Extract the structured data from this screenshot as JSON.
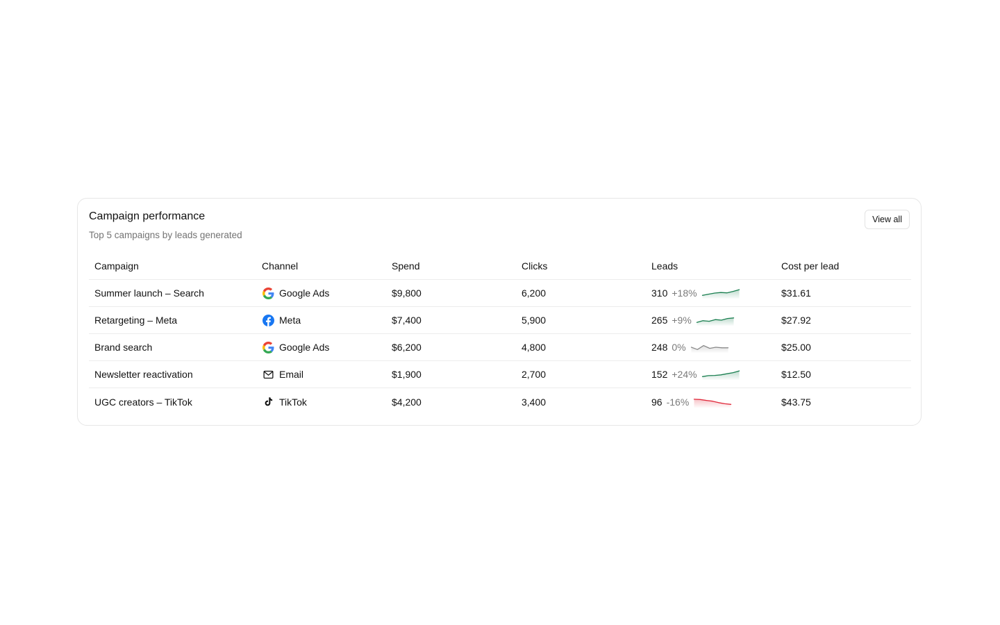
{
  "card": {
    "title": "Campaign performance",
    "subtitle": "Top 5 campaigns by leads generated",
    "view_all_label": "View all"
  },
  "table": {
    "headers": [
      "Campaign",
      "Channel",
      "Spend",
      "Clicks",
      "Leads",
      "Cost per lead"
    ],
    "rows": [
      {
        "campaign": "Summer launch – Search",
        "channel": "Google Ads",
        "channel_icon": "google-icon",
        "spend": "$9,800",
        "clicks": "6,200",
        "leads": "310",
        "delta": "+18%",
        "trend": "up",
        "spark": [
          2,
          3,
          4,
          4.5,
          4.2,
          5.5,
          7
        ],
        "cpl": "$31.61"
      },
      {
        "campaign": "Retargeting – Meta",
        "channel": "Meta",
        "channel_icon": "facebook-icon",
        "spend": "$7,400",
        "clicks": "5,900",
        "leads": "265",
        "delta": "+9%",
        "trend": "up",
        "spark": [
          2,
          3.5,
          3,
          4.5,
          4,
          5.5,
          6
        ],
        "cpl": "$27.92"
      },
      {
        "campaign": "Brand search",
        "channel": "Google Ads",
        "channel_icon": "google-icon",
        "spend": "$6,200",
        "clicks": "4,800",
        "leads": "248",
        "delta": "0%",
        "trend": "flat",
        "spark": [
          4,
          2,
          5.5,
          3,
          4,
          3.5,
          3.5
        ],
        "cpl": "$25.00"
      },
      {
        "campaign": "Newsletter reactivation",
        "channel": "Email",
        "channel_icon": "mail-icon",
        "spend": "$1,900",
        "clicks": "2,700",
        "leads": "152",
        "delta": "+24%",
        "trend": "up",
        "spark": [
          2,
          2.8,
          3,
          3.5,
          4.5,
          5.5,
          7
        ],
        "cpl": "$12.50"
      },
      {
        "campaign": "UGC creators – TikTok",
        "channel": "TikTok",
        "channel_icon": "tiktok-icon",
        "spend": "$4,200",
        "clicks": "3,400",
        "leads": "96",
        "delta": "-16%",
        "trend": "down",
        "spark": [
          6.5,
          6.3,
          5.5,
          4.8,
          3.5,
          2.5,
          2
        ],
        "cpl": "$43.75"
      }
    ]
  },
  "colors": {
    "up": "#1a7f50",
    "down": "#e0283a",
    "flat": "#8a8a8a"
  }
}
